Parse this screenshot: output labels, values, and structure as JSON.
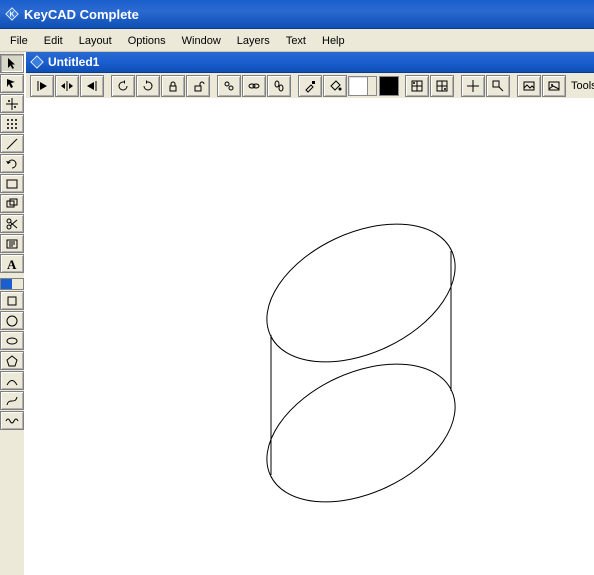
{
  "app": {
    "title": "KeyCAD Complete",
    "icon": "keycad-icon"
  },
  "menus": [
    "File",
    "Edit",
    "Layout",
    "Options",
    "Window",
    "Layers",
    "Text",
    "Help"
  ],
  "document": {
    "title": "Untitled1",
    "icon": "keycad-icon"
  },
  "left_tools": [
    {
      "id": "select-arrow",
      "active": true
    },
    {
      "id": "pointer-move",
      "active": false
    },
    {
      "id": "snap-grid",
      "active": false
    },
    {
      "id": "snap-point",
      "active": false
    },
    {
      "id": "line-tool",
      "active": false
    },
    {
      "id": "redo-tool",
      "active": false
    },
    {
      "id": "rectangle-tool",
      "active": false
    },
    {
      "id": "copy-rect-tool",
      "active": false
    },
    {
      "id": "scissors-tool",
      "active": false
    },
    {
      "id": "text-box-tool",
      "active": false
    },
    {
      "id": "text-A-tool",
      "active": false
    }
  ],
  "left_shape_tools": [
    {
      "id": "rect-shape",
      "active": false
    },
    {
      "id": "circle-shape",
      "active": false
    },
    {
      "id": "ellipse-shape",
      "active": false
    },
    {
      "id": "polygon-shape",
      "active": false
    },
    {
      "id": "arc-shape",
      "active": false
    },
    {
      "id": "spline-shape",
      "active": false
    },
    {
      "id": "wave-shape",
      "active": false
    }
  ],
  "doc_toolbar": {
    "nav_group": [
      "nav-prev",
      "nav-resize",
      "nav-next"
    ],
    "xform_group": [
      "rotate-ccw",
      "rotate-cw",
      "lock-a",
      "lock-b"
    ],
    "link_group": [
      "ungroup",
      "chain-a",
      "chain-b"
    ],
    "draw_group": [
      "eyedrop",
      "paint-bucket"
    ],
    "swatches": [
      "white",
      "black"
    ],
    "align_group": [
      "align-grid-a",
      "align-grid-b"
    ],
    "crosshair_group": [
      "crosshair",
      "corner"
    ],
    "view_group": [
      "picture-a",
      "picture-b"
    ],
    "tools_label": "Tools:",
    "tools_dropdown": "tools-dd"
  }
}
